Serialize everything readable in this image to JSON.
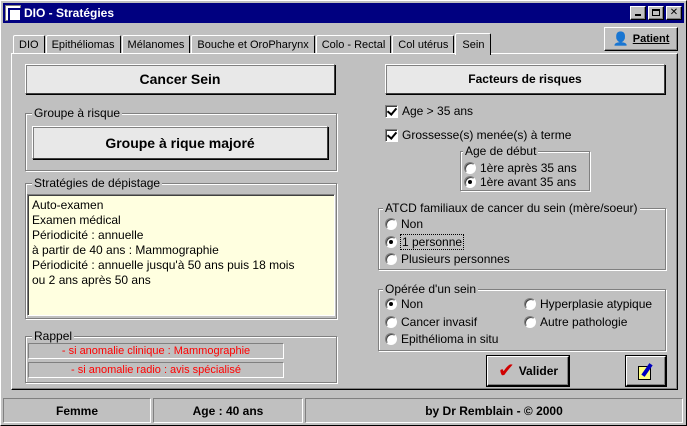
{
  "window": {
    "title": "DIO - Stratégies"
  },
  "tabs": [
    {
      "label": "DIO"
    },
    {
      "label": "Epithéliomas"
    },
    {
      "label": "Mélanomes"
    },
    {
      "label": "Bouche et OroPharynx"
    },
    {
      "label": "Colo - Rectal"
    },
    {
      "label": "Col utérus"
    },
    {
      "label": "Sein",
      "active": true
    }
  ],
  "patient_button": {
    "label": "Patient"
  },
  "left": {
    "header": "Cancer Sein",
    "risk_group": {
      "title": "Groupe à risque",
      "value": "Groupe à rique majoré"
    },
    "screening": {
      "title": "Stratégies de dépistage",
      "lines": [
        "Auto-examen",
        "Examen médical",
        "Périodicité : annuelle",
        "à partir de 40 ans : Mammographie",
        "Périodicité : annuelle jusqu'à 50 ans puis 18 mois",
        "ou 2 ans après 50 ans"
      ]
    },
    "reminder": {
      "title": "Rappel",
      "lines": [
        "- si anomalie clinique : Mammographie",
        "- si anomalie radio : avis spécialisé"
      ]
    }
  },
  "right": {
    "header": "Facteurs de risques",
    "age_check": {
      "label": "Age > 35 ans",
      "checked": true
    },
    "pregnancy_check": {
      "label": "Grossesse(s) menée(s) à terme",
      "checked": true
    },
    "start_age": {
      "title": "Age de début",
      "options": [
        "1ère après 35 ans",
        "1ère avant 35 ans"
      ],
      "selected": 1
    },
    "family_history": {
      "title": "ATCD familiaux de cancer du sein (mère/soeur)",
      "options": [
        "Non",
        "1 personne",
        "Plusieurs personnes"
      ],
      "selected": 1
    },
    "operated": {
      "title": "Opérée d'un sein",
      "options": [
        "Non",
        "Cancer invasif",
        "Epithélioma in situ",
        "Hyperplasie atypique",
        "Autre pathologie"
      ],
      "selected": 0
    },
    "validate_button": {
      "label": "Valider"
    }
  },
  "status": {
    "sex": "Femme",
    "age": "Age : 40 ans",
    "credit": "by Dr Remblain - © 2000"
  }
}
